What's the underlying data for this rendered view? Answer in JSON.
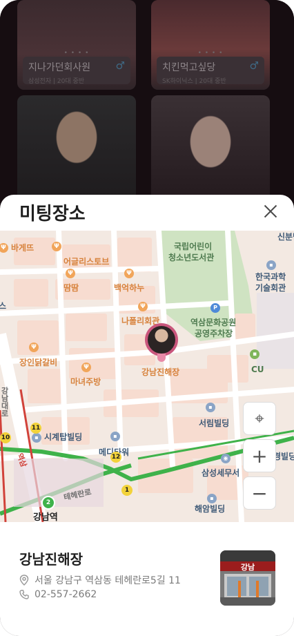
{
  "background_cards": [
    {
      "name": "지나가던회사원",
      "meta": "삼성전자 | 20대 중반",
      "dots": "• • • •"
    },
    {
      "name": "치킨먹고싶당",
      "meta": "SK하이닉스 | 20대 중반",
      "dots": "• • • •"
    }
  ],
  "sheet": {
    "title": "미팅장소"
  },
  "map": {
    "pois": [
      "바게뜨",
      "어글리스토브",
      "땀땀",
      "백억하누",
      "나폴리회관",
      "장인닭갈비",
      "마녀주방",
      "강남진해장",
      "CU"
    ],
    "labels": [
      "국립어린이",
      "청소년도서관",
      "한국과학",
      "기술회관",
      "역삼문화공원",
      "공영주차장",
      "서림빌딩",
      "시계탑빌딩",
      "메디타워",
      "삼성세무서",
      "경빌딩",
      "해암빌딩",
      "테헤란로",
      "강남역",
      "신분당선",
      "역삼",
      "스",
      "강남대로"
    ],
    "line_numbers": [
      "11",
      "10",
      "12",
      "1",
      "2"
    ],
    "marker_label": "강남진해장",
    "controls": {
      "locate": "⌖",
      "zoom_in": "+",
      "zoom_out": "−"
    }
  },
  "place": {
    "name": "강남진해장",
    "address": "서울 강남구 역삼동 테헤란로5길 11",
    "phone": "02-557-2662",
    "thumbnail_text": "강남"
  },
  "icons": {
    "close": "close-icon",
    "location_pin": "location-pin-icon",
    "phone": "phone-icon"
  },
  "colors": {
    "poi_orange": "#d7823c",
    "marker_pink": "#c9567c",
    "park_green": "#cfe3c2",
    "subway_green": "#3fb24a",
    "subway_red": "#d1423a"
  }
}
